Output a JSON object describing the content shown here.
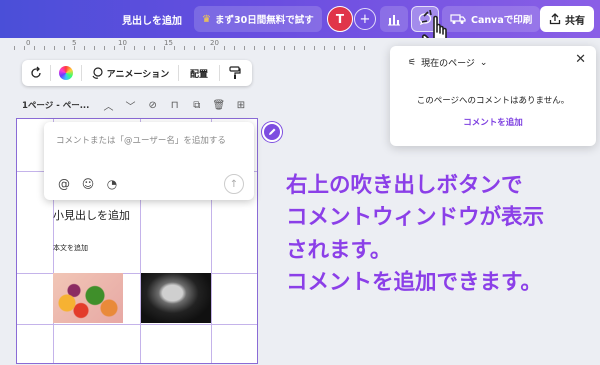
{
  "topbar": {
    "add_heading": "見出しを追加",
    "trial": "まず30日間無料で試す",
    "avatar_initial": "T",
    "canva_print": "Canvaで印刷",
    "share": "共有"
  },
  "ruler": [
    "0",
    "5",
    "10",
    "15",
    "20"
  ],
  "toolbar": {
    "animation": "アニメーション",
    "arrange": "配置"
  },
  "pagebar": {
    "page_label": "1ページ - ペー..."
  },
  "canvas": {
    "subheading": "小見出しを追加",
    "body": "本文を追加"
  },
  "comment_input": {
    "placeholder": "コメントまたは「@ユーザー名」を追加する"
  },
  "comments_panel": {
    "scope": "現在のページ",
    "empty_message": "このページへのコメントはありません。",
    "add_comment": "コメントを追加"
  },
  "annotation": {
    "lines": [
      "右上の吹き出しボタンで",
      "コメントウィンドウが表示",
      "されます。",
      "コメントを追加できます。"
    ]
  },
  "colors": {
    "topbar_start": "#4a4fd8",
    "topbar_end": "#8a5fe6",
    "accent": "#7d3fe0",
    "annotation": "#8b3fe8"
  }
}
